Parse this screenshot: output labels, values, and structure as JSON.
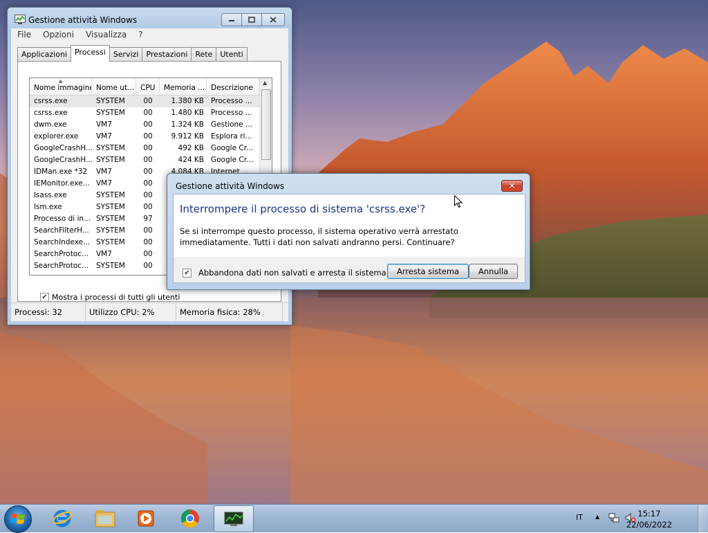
{
  "task_manager": {
    "title": "Gestione attività Windows",
    "menu": [
      "File",
      "Opzioni",
      "Visualizza",
      "?"
    ],
    "tabs": [
      "Applicazioni",
      "Processi",
      "Servizi",
      "Prestazioni",
      "Rete",
      "Utenti"
    ],
    "active_tab": "Processi",
    "columns": [
      "Nome immagine",
      "Nome ut...",
      "CPU",
      "Memoria ...",
      "Descrizione"
    ],
    "rows": [
      {
        "name": "csrss.exe",
        "user": "SYSTEM",
        "cpu": "00",
        "mem": "1.380 KB",
        "desc": "Processo ..."
      },
      {
        "name": "csrss.exe",
        "user": "SYSTEM",
        "cpu": "00",
        "mem": "1.480 KB",
        "desc": "Processo ..."
      },
      {
        "name": "dwm.exe",
        "user": "VM7",
        "cpu": "00",
        "mem": "1.324 KB",
        "desc": "Gestione ..."
      },
      {
        "name": "explorer.exe",
        "user": "VM7",
        "cpu": "00",
        "mem": "9.912 KB",
        "desc": "Esplora ri..."
      },
      {
        "name": "GoogleCrashH...",
        "user": "SYSTEM",
        "cpu": "00",
        "mem": "492 KB",
        "desc": "Google Cr..."
      },
      {
        "name": "GoogleCrashH...",
        "user": "SYSTEM",
        "cpu": "00",
        "mem": "424 KB",
        "desc": "Google Cr..."
      },
      {
        "name": "IDMan.exe *32",
        "user": "VM7",
        "cpu": "00",
        "mem": "4.084 KB",
        "desc": "Internet ..."
      },
      {
        "name": "IEMonitor.exe...",
        "user": "VM7",
        "cpu": "00",
        "mem": "",
        "desc": ""
      },
      {
        "name": "lsass.exe",
        "user": "SYSTEM",
        "cpu": "00",
        "mem": "",
        "desc": ""
      },
      {
        "name": "lsm.exe",
        "user": "SYSTEM",
        "cpu": "00",
        "mem": "",
        "desc": ""
      },
      {
        "name": "Processo di in...",
        "user": "SYSTEM",
        "cpu": "97",
        "mem": "",
        "desc": ""
      },
      {
        "name": "SearchFilterH...",
        "user": "SYSTEM",
        "cpu": "00",
        "mem": "",
        "desc": ""
      },
      {
        "name": "SearchIndexe...",
        "user": "SYSTEM",
        "cpu": "00",
        "mem": "",
        "desc": ""
      },
      {
        "name": "SearchProtoc...",
        "user": "VM7",
        "cpu": "00",
        "mem": "",
        "desc": ""
      },
      {
        "name": "SearchProtoc...",
        "user": "SYSTEM",
        "cpu": "00",
        "mem": "",
        "desc": ""
      }
    ],
    "show_all_label": "Mostra i processi di tutti gli utenti",
    "show_all_checked": true,
    "status": {
      "processes": "Processi: 32",
      "cpu": "Utilizzo CPU: 2%",
      "memory": "Memoria fisica: 28%"
    }
  },
  "dialog": {
    "title": "Gestione attività Windows",
    "heading": "Interrompere il processo di sistema 'csrss.exe'?",
    "message": "Se si interrompe questo processo, il sistema operativo verrà arrestato immediatamente. Tutti i dati non salvati andranno persi. Continuare?",
    "checkbox_label": "Abbandona dati non salvati e arresta il sistema.",
    "checkbox_checked": true,
    "confirm_label": "Arresta sistema",
    "cancel_label": "Annulla",
    "close_glyph": "✕"
  },
  "taskbar": {
    "pinned": [
      "start-orb-icon",
      "internet-explorer-icon",
      "file-explorer-icon",
      "media-player-icon",
      "chrome-icon",
      "task-manager-icon"
    ],
    "language": "IT",
    "tray_arrow": "▲",
    "time": "15:17",
    "date": "22/06/2022"
  }
}
